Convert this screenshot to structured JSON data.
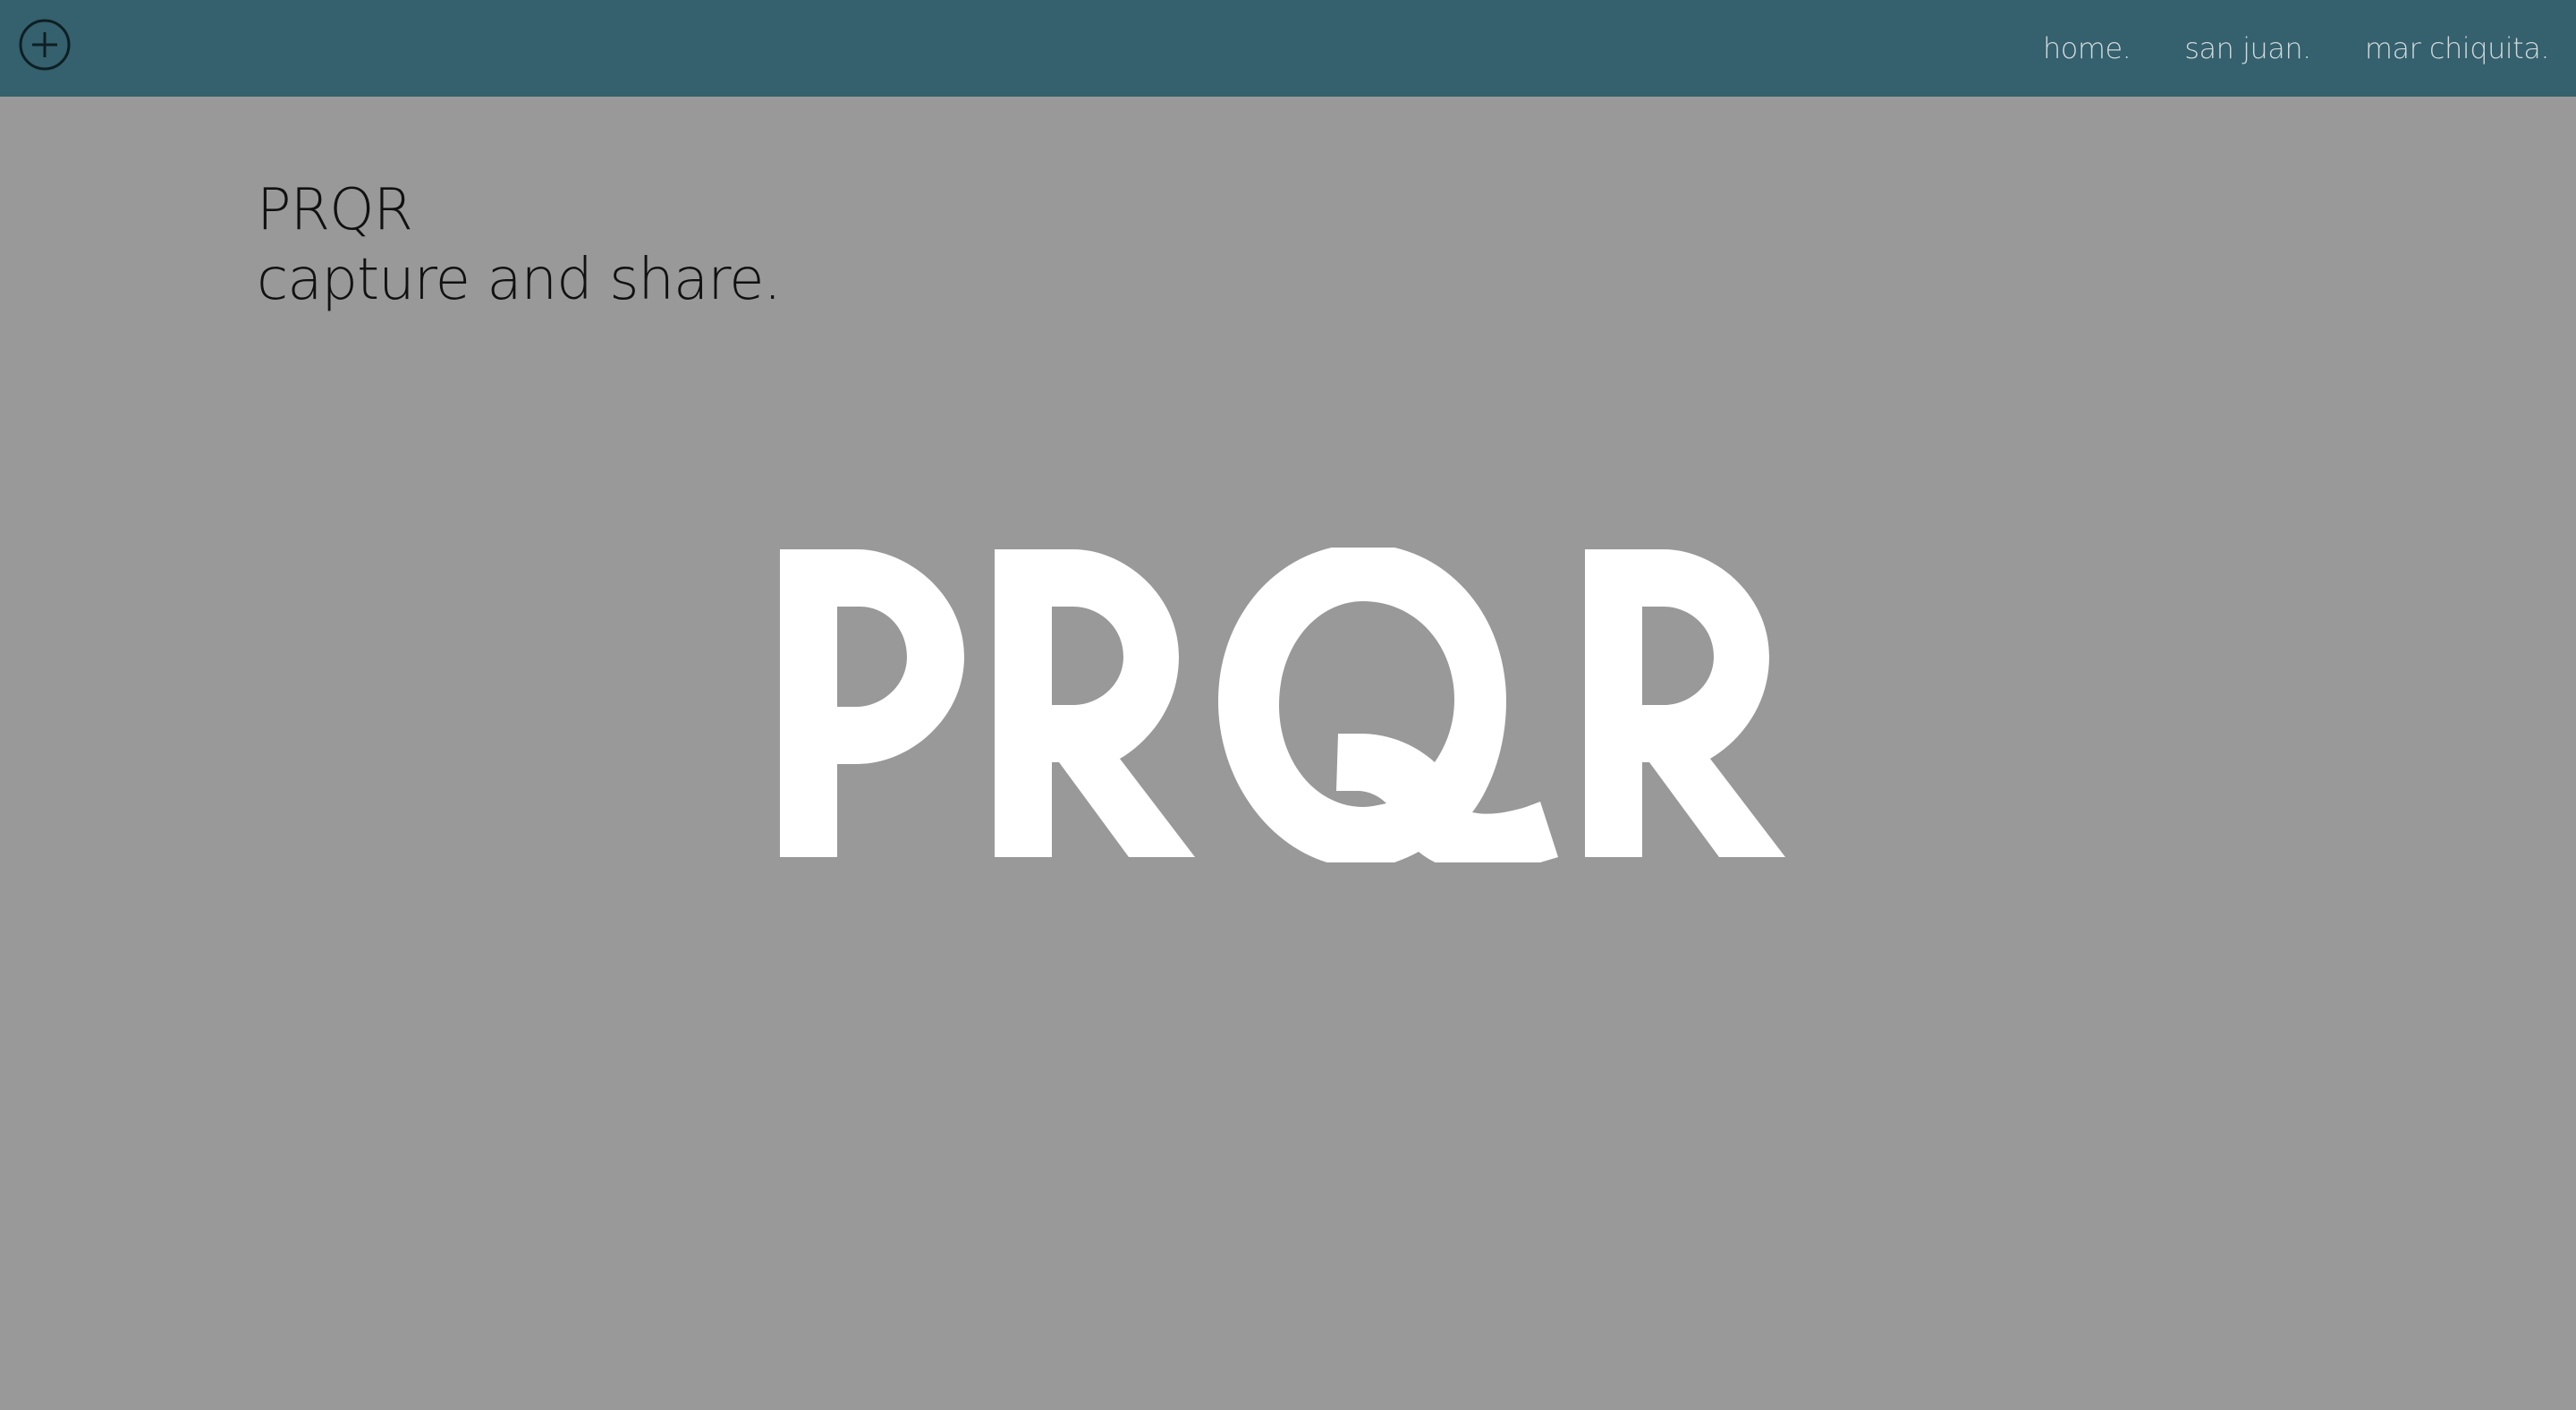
{
  "header": {
    "add_icon": "circle-plus-icon",
    "nav": [
      {
        "label": "home."
      },
      {
        "label": "san juan."
      },
      {
        "label": "mar chiquita."
      }
    ]
  },
  "intro": {
    "title": "PRQR",
    "tagline": "capture and share."
  },
  "logo": {
    "text": "PRQR",
    "color": "#ffffff"
  },
  "colors": {
    "header_bg": "#35606d",
    "page_bg": "#999999",
    "nav_text": "#cfd9dc",
    "intro_text": "#111111"
  }
}
